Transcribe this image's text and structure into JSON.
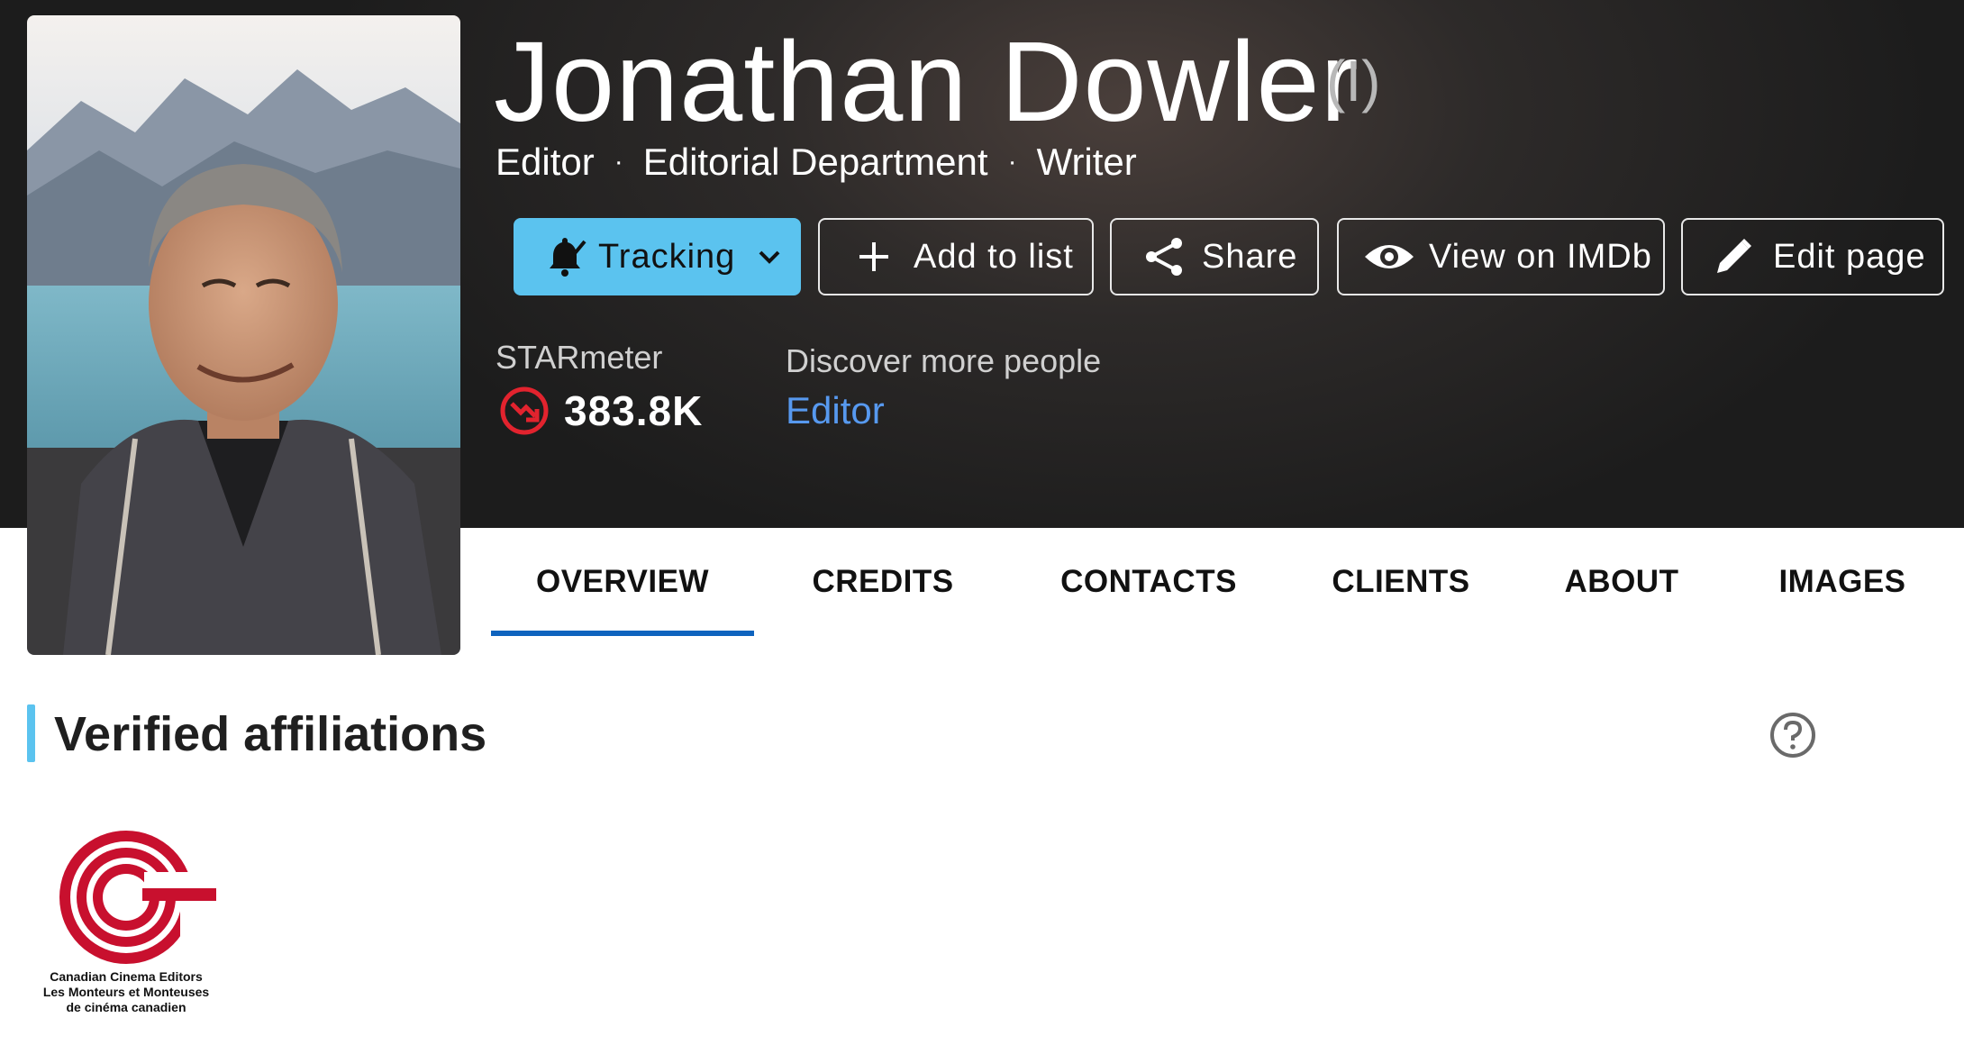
{
  "profile": {
    "name": "Jonathan Dowler",
    "name_suffix": "(I)",
    "roles": [
      "Editor",
      "Editorial Department",
      "Writer"
    ]
  },
  "actions": {
    "tracking": "Tracking",
    "add_to_list": "Add to list",
    "share": "Share",
    "view_on_imdb": "View on IMDb",
    "edit_page": "Edit page"
  },
  "starmeter": {
    "label": "STARmeter",
    "value": "383.8K",
    "trend": "down"
  },
  "discover": {
    "label": "Discover more people",
    "link": "Editor"
  },
  "tabs": [
    "OVERVIEW",
    "CREDITS",
    "CONTACTS",
    "CLIENTS",
    "ABOUT",
    "IMAGES"
  ],
  "active_tab": "OVERVIEW",
  "affiliations": {
    "title": "Verified affiliations",
    "items": [
      {
        "name_en": "Canadian Cinema Editors",
        "name_fr_1": "Les Monteurs et Monteuses",
        "name_fr_2": "de cinéma canadien"
      }
    ]
  },
  "colors": {
    "accent_cyan": "#5bc3ef",
    "link_blue": "#5799ef",
    "tab_underline": "#0e63be",
    "starmeter_down": "#e2232e",
    "logo_red": "#c8102e"
  }
}
